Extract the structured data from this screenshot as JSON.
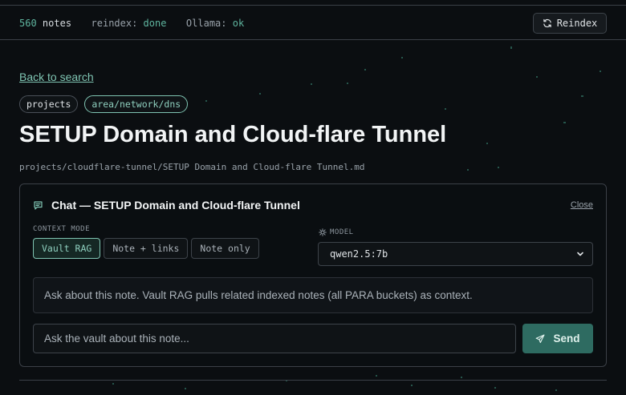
{
  "status": {
    "notes_count": "560",
    "notes_label": "notes",
    "reindex_label": "reindex:",
    "reindex_value": "done",
    "ollama_label": "Ollama:",
    "ollama_value": "ok",
    "reindex_button": "Reindex"
  },
  "note": {
    "back_link": "Back to search",
    "tags": [
      "projects",
      "area/network/dns"
    ],
    "title": "SETUP Domain and Cloud-flare Tunnel",
    "path": "projects/cloudflare-tunnel/SETUP Domain and Cloud-flare Tunnel.md"
  },
  "chat": {
    "title": "Chat — SETUP Domain and Cloud-flare Tunnel",
    "close_label": "Close",
    "context_mode_label": "CONTEXT MODE",
    "modes": [
      "Vault RAG",
      "Note + links",
      "Note only"
    ],
    "active_mode": "Vault RAG",
    "model_label": "MODEL",
    "model_value": "qwen2.5:7b",
    "info_text": "Ask about this note. Vault RAG pulls related indexed notes (all PARA buckets) as context.",
    "input_placeholder": "Ask the vault about this note...",
    "send_label": "Send"
  },
  "colors": {
    "accent": "#7fc4b2",
    "background": "#0b0e11",
    "send_button": "#2e6b61"
  }
}
